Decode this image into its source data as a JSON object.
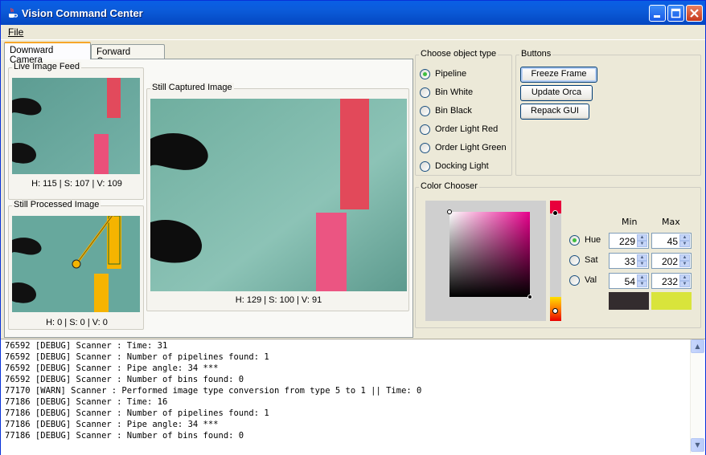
{
  "window": {
    "title": "Vision Command Center",
    "icon": "java-cup-icon",
    "controls": {
      "minimize": "minimize-icon",
      "maximize": "maximize-icon",
      "close": "close-icon"
    }
  },
  "menu": {
    "file": "File"
  },
  "tabs": [
    {
      "label": "Downward Camera",
      "active": true
    },
    {
      "label": "Forward Camera",
      "active": false
    }
  ],
  "panels": {
    "live": {
      "title": "Live Image Feed",
      "hsv": "H: 115 | S: 107 | V: 109"
    },
    "processed": {
      "title": "Still Processed Image",
      "hsv": "H: 0 | S: 0 | V: 0"
    },
    "captured": {
      "title": "Still Captured Image",
      "hsv": "H: 129 | S: 100 | V: 91"
    }
  },
  "object_type": {
    "title": "Choose object type",
    "options": [
      {
        "label": "Pipeline",
        "selected": true
      },
      {
        "label": "Bin White",
        "selected": false
      },
      {
        "label": "Bin Black",
        "selected": false
      },
      {
        "label": "Order Light Red",
        "selected": false
      },
      {
        "label": "Order Light Green",
        "selected": false
      },
      {
        "label": "Docking Light",
        "selected": false
      }
    ]
  },
  "buttons": {
    "title": "Buttons",
    "items": [
      "Freeze Frame",
      "Update Orca",
      "Repack GUI"
    ]
  },
  "color_chooser": {
    "title": "Color Chooser",
    "col_min": "Min",
    "col_max": "Max",
    "rows": [
      {
        "label": "Hue",
        "min": "229",
        "max": "45",
        "selected": true
      },
      {
        "label": "Sat",
        "min": "33",
        "max": "202",
        "selected": false
      },
      {
        "label": "Val",
        "min": "54",
        "max": "232",
        "selected": false
      }
    ],
    "min_swatch": "#332c2e",
    "max_swatch": "#d9e43b",
    "hue_color": "#e8008c"
  },
  "log": {
    "lines": [
      "76592 [DEBUG] Scanner : Time: 31",
      "76592 [DEBUG] Scanner : Number of pipelines found: 1",
      "76592 [DEBUG] Scanner : Pipe angle: 34 ***",
      "76592 [DEBUG] Scanner : Number of bins found: 0",
      "77170 [WARN] Scanner : Performed image type conversion from type 5 to 1 || Time: 0",
      "77186 [DEBUG] Scanner : Time: 16",
      "77186 [DEBUG] Scanner : Number of pipelines found: 1",
      "77186 [DEBUG] Scanner : Pipe angle: 34 ***",
      "77186 [DEBUG] Scanner : Number of bins found: 0"
    ]
  }
}
